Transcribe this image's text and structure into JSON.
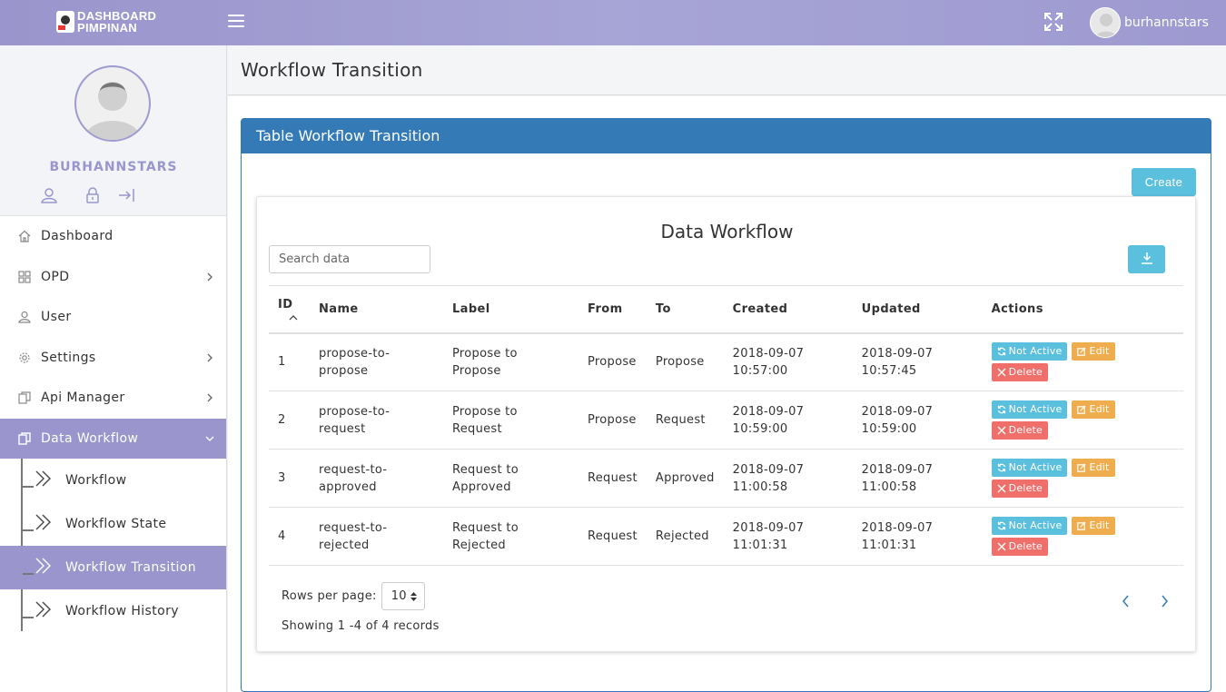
{
  "brand": {
    "line1": "DASHBOARD",
    "line2": "PIMPINAN"
  },
  "topbar": {
    "username": "burhannstars"
  },
  "sidebar": {
    "profile_name": "BURHANNSTARS",
    "menu": [
      {
        "label": "Dashboard"
      },
      {
        "label": "OPD"
      },
      {
        "label": "User"
      },
      {
        "label": "Settings"
      },
      {
        "label": "Api Manager"
      },
      {
        "label": "Data Workflow"
      }
    ],
    "submenu": [
      {
        "label": "Workflow"
      },
      {
        "label": "Workflow State"
      },
      {
        "label": "Workflow Transition"
      },
      {
        "label": "Workflow History"
      }
    ]
  },
  "page": {
    "title": "Workflow Transition"
  },
  "panel": {
    "title": "Table Workflow Transition",
    "create_label": "Create"
  },
  "card": {
    "title": "Data Workflow",
    "search_placeholder": "Search data",
    "columns": [
      "ID",
      "Name",
      "Label",
      "From",
      "To",
      "Created",
      "Updated",
      "Actions"
    ],
    "rows": [
      {
        "id": "1",
        "name": "propose-to-propose",
        "label": "Propose to Propose",
        "from": "Propose",
        "to": "Propose",
        "created": "2018-09-07 10:57:00",
        "updated": "2018-09-07 10:57:45"
      },
      {
        "id": "2",
        "name": "propose-to-request",
        "label": "Propose to Request",
        "from": "Propose",
        "to": "Request",
        "created": "2018-09-07 10:59:00",
        "updated": "2018-09-07 10:59:00"
      },
      {
        "id": "3",
        "name": "request-to-approved",
        "label": "Request to Approved",
        "from": "Request",
        "to": "Approved",
        "created": "2018-09-07 11:00:58",
        "updated": "2018-09-07 11:00:58"
      },
      {
        "id": "4",
        "name": "request-to-rejected",
        "label": "Request to Rejected",
        "from": "Request",
        "to": "Rejected",
        "created": "2018-09-07 11:01:31",
        "updated": "2018-09-07 11:01:31"
      }
    ],
    "actions": {
      "status": "Not Active",
      "edit": "Edit",
      "delete": "Delete"
    },
    "rows_per_page_label": "Rows per page:",
    "rows_per_page_value": "10",
    "showing_text": "Showing 1 -4 of 4 records"
  },
  "colors": {
    "accent": "#9a95cc",
    "primary": "#337ab7",
    "info": "#5bc0de",
    "warning": "#f0ad4e",
    "danger": "#f16f6b"
  }
}
